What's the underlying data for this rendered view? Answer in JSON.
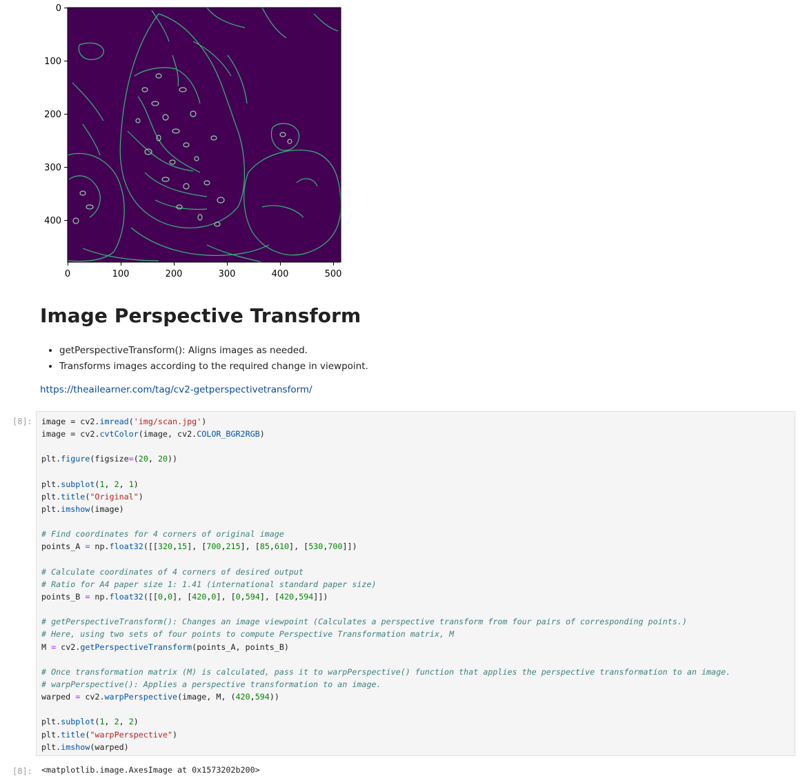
{
  "plot": {
    "colors": {
      "background": "#440154",
      "edges": "#35b779",
      "edges_alt": "#8fd3a0"
    },
    "x_ticks": [
      "0",
      "100",
      "200",
      "300",
      "400",
      "500"
    ],
    "y_ticks": [
      "0",
      "100",
      "200",
      "300",
      "400"
    ]
  },
  "markdown": {
    "heading": "Image Perspective Transform",
    "bullets": [
      "getPerspectiveTransform(): Aligns images as needed.",
      "Transforms images according to the required change in viewpoint."
    ],
    "link": "https://theailearner.com/tag/cv2-getperspectivetransform/"
  },
  "cell": {
    "input_prompt": "[8]:",
    "output_prompt": "[8]:",
    "code": {
      "l1": {
        "a": "image",
        "b": " = cv2.",
        "c": "imread",
        "d": "(",
        "e": "'img/scan.jpg'",
        "f": ")"
      },
      "l2": {
        "a": "image",
        "b": " = cv2.",
        "c": "cvtColor",
        "d": "(image, cv2.",
        "e": "COLOR_BGR2RGB",
        "f": ")"
      },
      "l3": {
        "a": "plt.",
        "b": "figure",
        "c": "(figsize",
        "d": "=",
        "e": "(",
        "f": "20",
        "g": ", ",
        "h": "20",
        "i": "))"
      },
      "l4": {
        "a": "plt.",
        "b": "subplot",
        "c": "(",
        "d": "1",
        "e": ", ",
        "f": "2",
        "g": ", ",
        "h": "1",
        "i": ")"
      },
      "l5": {
        "a": "plt.",
        "b": "title",
        "c": "(",
        "d": "\"Original\"",
        "e": ")"
      },
      "l6": {
        "a": "plt.",
        "b": "imshow",
        "c": "(image)"
      },
      "l7": "# Find coordinates for 4 corners of original image",
      "l8": {
        "a": "points_A ",
        "b": "=",
        "c": " np.",
        "d": "float32",
        "e": "([[",
        "f": "320",
        "g": ",",
        "h": "15",
        "i": "], [",
        "j": "700",
        "k": ",",
        "l": "215",
        "m": "], [",
        "n": "85",
        "o": ",",
        "p": "610",
        "q": "], [",
        "r": "530",
        "s": ",",
        "t": "700",
        "u": "]])"
      },
      "l9": "# Calculate coordinates of 4 corners of desired output",
      "l10": "# Ratio for A4 paper size 1: 1.41 (international standard paper size)",
      "l11": {
        "a": "points_B ",
        "b": "=",
        "c": " np.",
        "d": "float32",
        "e": "([[",
        "f": "0",
        "g": ",",
        "h": "0",
        "i": "], [",
        "j": "420",
        "k": ",",
        "l": "0",
        "m": "], [",
        "n": "0",
        "o": ",",
        "p": "594",
        "q": "], [",
        "r": "420",
        "s": ",",
        "t": "594",
        "u": "]])"
      },
      "l12": "# getPerspectiveTransform(): Changes an image viewpoint (Calculates a perspective transform from four pairs of corresponding points.)",
      "l13": "# Here, using two sets of four points to compute Perspective Transformation matrix, M",
      "l14": {
        "a": "M ",
        "b": "=",
        "c": " cv2.",
        "d": "getPerspectiveTransform",
        "e": "(points_A, points_B)"
      },
      "l15": "# Once transformation matrix (M) is calculated, pass it to warpPerspective() function that applies the perspective transformation to an image.",
      "l16": "# warpPerspective(): Applies a perspective transformation to an image.",
      "l17": {
        "a": "warped ",
        "b": "=",
        "c": " cv2.",
        "d": "warpPerspective",
        "e": "(image, M, (",
        "f": "420",
        "g": ",",
        "h": "594",
        "i": "))"
      },
      "l18": {
        "a": "plt.",
        "b": "subplot",
        "c": "(",
        "d": "1",
        "e": ", ",
        "f": "2",
        "g": ", ",
        "h": "2",
        "i": ")"
      },
      "l19": {
        "a": "plt.",
        "b": "title",
        "c": "(",
        "d": "\"warpPerspective\"",
        "e": ")"
      },
      "l20": {
        "a": "plt.",
        "b": "imshow",
        "c": "(warped)"
      }
    },
    "output": "<matplotlib.image.AxesImage at 0x1573202b200>"
  }
}
